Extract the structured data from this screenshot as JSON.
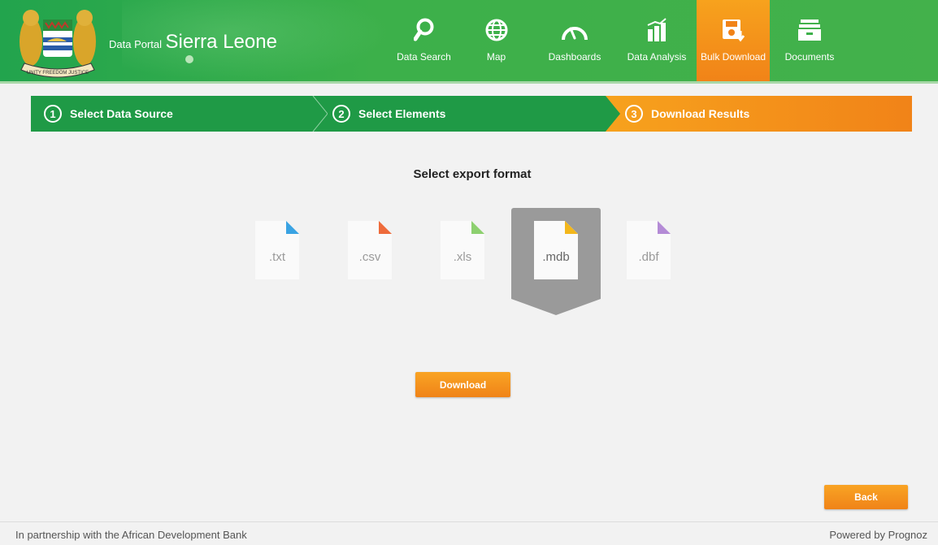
{
  "header": {
    "brand_small": "Data Portal",
    "brand_big": "Sierra Leone",
    "nav": [
      {
        "label": "Data Search",
        "icon": "search-icon"
      },
      {
        "label": "Map",
        "icon": "globe-icon"
      },
      {
        "label": "Dashboards",
        "icon": "gauge-icon"
      },
      {
        "label": "Data Analysis",
        "icon": "bar-chart-icon"
      },
      {
        "label": "Bulk Download",
        "icon": "floppy-download-icon",
        "active": true
      },
      {
        "label": "Documents",
        "icon": "file-box-icon"
      }
    ]
  },
  "steps": [
    {
      "num": "1",
      "label": "Select Data Source"
    },
    {
      "num": "2",
      "label": "Select Elements"
    },
    {
      "num": "3",
      "label": "Download Results",
      "active": true
    }
  ],
  "main": {
    "title": "Select export format",
    "formats": [
      {
        "ext": ".txt",
        "color": "#3aa3e3"
      },
      {
        "ext": ".csv",
        "color": "#ee6b3b"
      },
      {
        "ext": ".xls",
        "color": "#8dd06f"
      },
      {
        "ext": ".mdb",
        "color": "#f3b71b",
        "selected": true
      },
      {
        "ext": ".dbf",
        "color": "#b48bd6"
      }
    ],
    "download_label": "Download",
    "back_label": "Back"
  },
  "footer": {
    "left": "In partnership with the African Development Bank",
    "right": "Powered by Prognoz"
  },
  "colors": {
    "green": "#1f9a46",
    "orange": "#f18318"
  }
}
